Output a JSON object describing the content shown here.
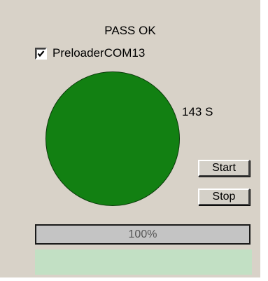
{
  "status_text": "PASS OK",
  "port": {
    "checked": true,
    "label": "PreloaderCOM13"
  },
  "indicator": {
    "state": "pass",
    "color": "#128012"
  },
  "timer_text": "143 S",
  "buttons": {
    "start_label": "Start",
    "stop_label": "Stop"
  },
  "progress": {
    "percent": 100,
    "label": "100%"
  },
  "colors": {
    "panel_bg": "#d8d2c8",
    "log_area_bg": "#c2e0c4"
  }
}
